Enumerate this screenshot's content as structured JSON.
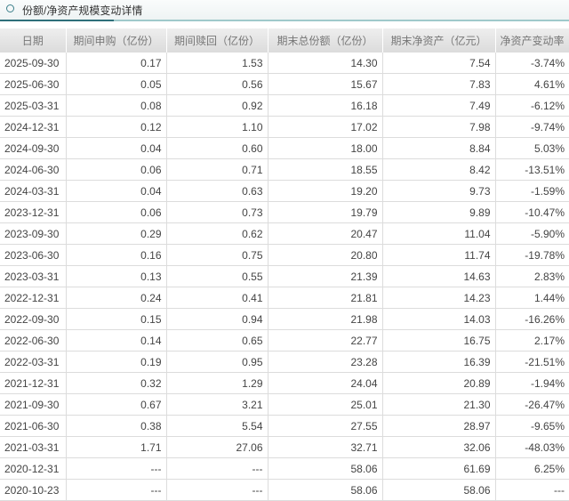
{
  "section": {
    "title": "份额/净资产规模变动详情",
    "icon": "circle-icon"
  },
  "table": {
    "headers": [
      "日期",
      "期间申购（亿份）",
      "期间赎回（亿份）",
      "期末总份额（亿份）",
      "期末净资产（亿元）",
      "净资产变动率"
    ],
    "rows": [
      [
        "2025-09-30",
        "0.17",
        "1.53",
        "14.30",
        "7.54",
        "-3.74%"
      ],
      [
        "2025-06-30",
        "0.05",
        "0.56",
        "15.67",
        "7.83",
        "4.61%"
      ],
      [
        "2025-03-31",
        "0.08",
        "0.92",
        "16.18",
        "7.49",
        "-6.12%"
      ],
      [
        "2024-12-31",
        "0.12",
        "1.10",
        "17.02",
        "7.98",
        "-9.74%"
      ],
      [
        "2024-09-30",
        "0.04",
        "0.60",
        "18.00",
        "8.84",
        "5.03%"
      ],
      [
        "2024-06-30",
        "0.06",
        "0.71",
        "18.55",
        "8.42",
        "-13.51%"
      ],
      [
        "2024-03-31",
        "0.04",
        "0.63",
        "19.20",
        "9.73",
        "-1.59%"
      ],
      [
        "2023-12-31",
        "0.06",
        "0.73",
        "19.79",
        "9.89",
        "-10.47%"
      ],
      [
        "2023-09-30",
        "0.29",
        "0.62",
        "20.47",
        "11.04",
        "-5.90%"
      ],
      [
        "2023-06-30",
        "0.16",
        "0.75",
        "20.80",
        "11.74",
        "-19.78%"
      ],
      [
        "2023-03-31",
        "0.13",
        "0.55",
        "21.39",
        "14.63",
        "2.83%"
      ],
      [
        "2022-12-31",
        "0.24",
        "0.41",
        "21.81",
        "14.23",
        "1.44%"
      ],
      [
        "2022-09-30",
        "0.15",
        "0.94",
        "21.98",
        "14.03",
        "-16.26%"
      ],
      [
        "2022-06-30",
        "0.14",
        "0.65",
        "22.77",
        "16.75",
        "2.17%"
      ],
      [
        "2022-03-31",
        "0.19",
        "0.95",
        "23.28",
        "16.39",
        "-21.51%"
      ],
      [
        "2021-12-31",
        "0.32",
        "1.29",
        "24.04",
        "20.89",
        "-1.94%"
      ],
      [
        "2021-09-30",
        "0.67",
        "3.21",
        "25.01",
        "21.30",
        "-26.47%"
      ],
      [
        "2021-06-30",
        "0.38",
        "5.54",
        "27.55",
        "28.97",
        "-9.65%"
      ],
      [
        "2021-03-31",
        "1.71",
        "27.06",
        "32.71",
        "32.06",
        "-48.03%"
      ],
      [
        "2020-12-31",
        "---",
        "---",
        "58.06",
        "61.69",
        "6.25%"
      ],
      [
        "2020-10-23",
        "---",
        "---",
        "58.06",
        "58.06",
        "---"
      ]
    ]
  }
}
